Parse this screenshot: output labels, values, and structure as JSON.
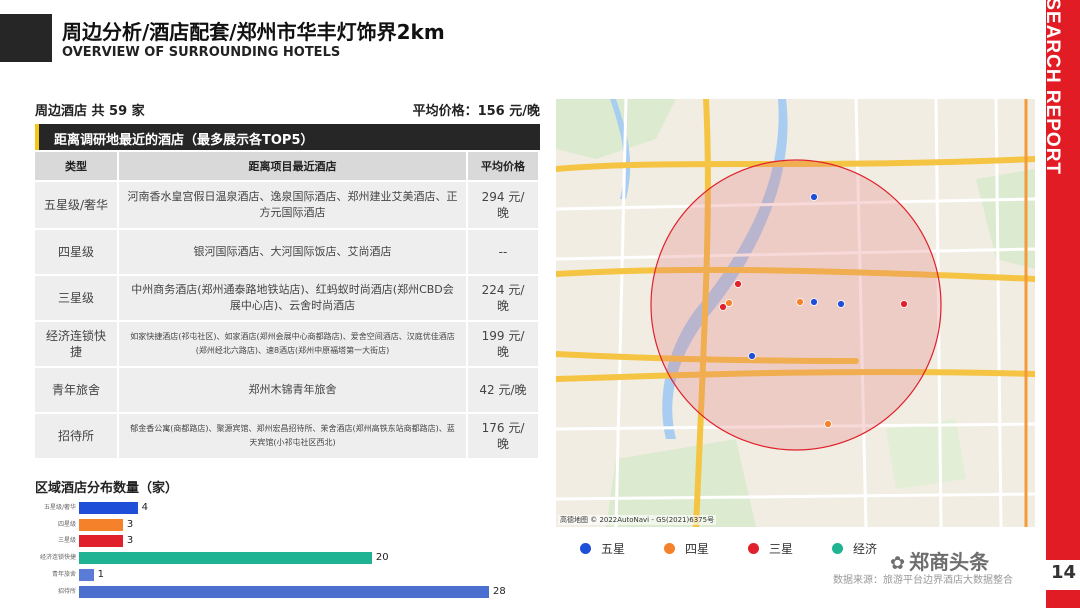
{
  "header": {
    "title": "周边分析/酒店配套/郑州市华丰灯饰界2km",
    "subtitle": "OVERVIEW OF SURROUNDING HOTELS"
  },
  "sidebar": {
    "label": "RESEARCH REPORT",
    "page_number": "14",
    "color": "#e21c24"
  },
  "summary": {
    "total": "周边酒店 共 59 家",
    "avg_price": "平均价格：156 元/晚"
  },
  "table": {
    "caption": "距离调研地最近的酒店（最多展示各TOP5）",
    "headers": [
      "类型",
      "距离项目最近酒店",
      "平均价格"
    ],
    "rows": [
      {
        "type": "五星级/奢华",
        "hotels": "河南香水皇宫假日温泉酒店、逸泉国际酒店、郑州建业艾美酒店、正方元国际酒店",
        "price": "294 元/晚"
      },
      {
        "type": "四星级",
        "hotels": "银河国际酒店、大河国际饭店、艾尚酒店",
        "price": "--"
      },
      {
        "type": "三星级",
        "hotels": "中州商务酒店(郑州通泰路地铁站店)、红蚂蚁时尚酒店(郑州CBD会展中心店)、云舍时尚酒店",
        "price": "224 元/晚"
      },
      {
        "type": "经济连锁快捷",
        "hotels": "如家快捷酒店(祁屯社区)、如家酒店(郑州会展中心商都路店)、爱舍空间酒店、汉庭优佳酒店(郑州经北六路店)、速8酒店(郑州中原福塔第一大街店)",
        "price": "199 元/晚"
      },
      {
        "type": "青年旅舍",
        "hotels": "郑州木锦青年旅舍",
        "price": "42 元/晚"
      },
      {
        "type": "招待所",
        "hotels": "郁金香公寓(商都路店)、聚源宾馆、郑州宏昌招待所、茉舍酒店(郑州高铁东站商都路店)、蓝天宾馆(小祁屯社区西北)",
        "price": "176 元/晚"
      }
    ]
  },
  "distribution": {
    "title": "区域酒店分布数量（家）",
    "bars": [
      {
        "label": "五星级/奢华",
        "value": 4,
        "color": "#1f4fd8"
      },
      {
        "label": "四星级",
        "value": 3,
        "color": "#f5822a"
      },
      {
        "label": "三星级",
        "value": 3,
        "color": "#e0212b"
      },
      {
        "label": "经济连锁快捷",
        "value": 20,
        "color": "#1fb394"
      },
      {
        "label": "青年旅舍",
        "value": 1,
        "color": "#5a7bd6"
      },
      {
        "label": "招待所",
        "value": 28,
        "color": "#4a6fcf"
      }
    ]
  },
  "map": {
    "credit": "高德地图 © 2022AutoNavi - GS(2021)6375号",
    "markers": [
      {
        "kind": "五星",
        "color": "#1f4fd8"
      },
      {
        "kind": "五星",
        "color": "#1f4fd8"
      },
      {
        "kind": "五星",
        "color": "#1f4fd8"
      },
      {
        "kind": "五星",
        "color": "#1f4fd8"
      },
      {
        "kind": "四星",
        "color": "#f5822a"
      },
      {
        "kind": "四星",
        "color": "#f5822a"
      },
      {
        "kind": "四星",
        "color": "#f5822a"
      },
      {
        "kind": "三星",
        "color": "#e0212b"
      },
      {
        "kind": "三星",
        "color": "#e0212b"
      },
      {
        "kind": "三星",
        "color": "#e0212b"
      }
    ]
  },
  "legend": [
    {
      "label": "五星",
      "color": "#1f4fd8"
    },
    {
      "label": "四星",
      "color": "#f5822a"
    },
    {
      "label": "三星",
      "color": "#e0212b"
    },
    {
      "label": "经济",
      "color": "#1fb394"
    }
  ],
  "footer": {
    "watermark": "郑商头条",
    "source": "数据来源：旅游平台边界酒店大数据整合"
  }
}
